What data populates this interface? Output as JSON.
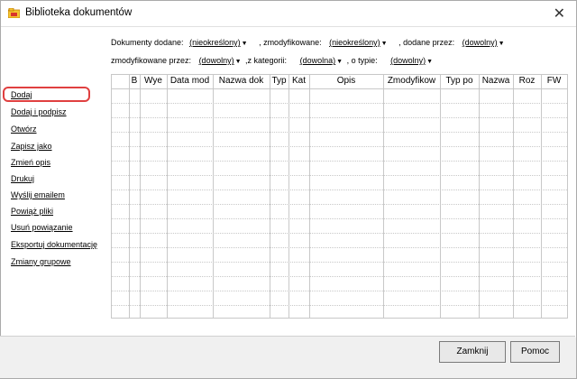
{
  "window": {
    "title": "Biblioteka dokumentów",
    "icon": "app-icon",
    "close_glyph": "✕"
  },
  "filters": {
    "row1": [
      {
        "label": "Dokumenty dodane:",
        "value": "(nieokreślony)"
      },
      {
        "label": ", zmodyfikowane:",
        "value": "(nieokreślony)"
      },
      {
        "label": ", dodane przez:",
        "value": "(dowolny)"
      }
    ],
    "row2": [
      {
        "label": "zmodyfikowane przez:",
        "value": "(dowolny)"
      },
      {
        "label": ",z kategorii:",
        "value": "(dowolna)"
      },
      {
        "label": ", o typie:",
        "value": "(dowolny)"
      }
    ],
    "arrow_glyph": "▼"
  },
  "actions": [
    "Dodaj",
    "Dodaj i podpisz",
    "Otwórz",
    "Zapisz jako",
    "Zmień opis",
    "Drukuj",
    "Wyślij emailem",
    "Powiąż pliki",
    "Usuń powiązanie",
    "Eksportuj dokumentację",
    "Zmiany grupowe"
  ],
  "grid": {
    "columns": [
      "",
      "B",
      "Wye",
      "Data mod",
      "Nazwa dok",
      "Typ",
      "Kat",
      "Opis",
      "Zmodyfikow",
      "Typ po",
      "Nazwa",
      "Roz",
      "FW"
    ]
  },
  "buttons": {
    "close_label": "Zamknij",
    "help_label": "Pomoc"
  }
}
